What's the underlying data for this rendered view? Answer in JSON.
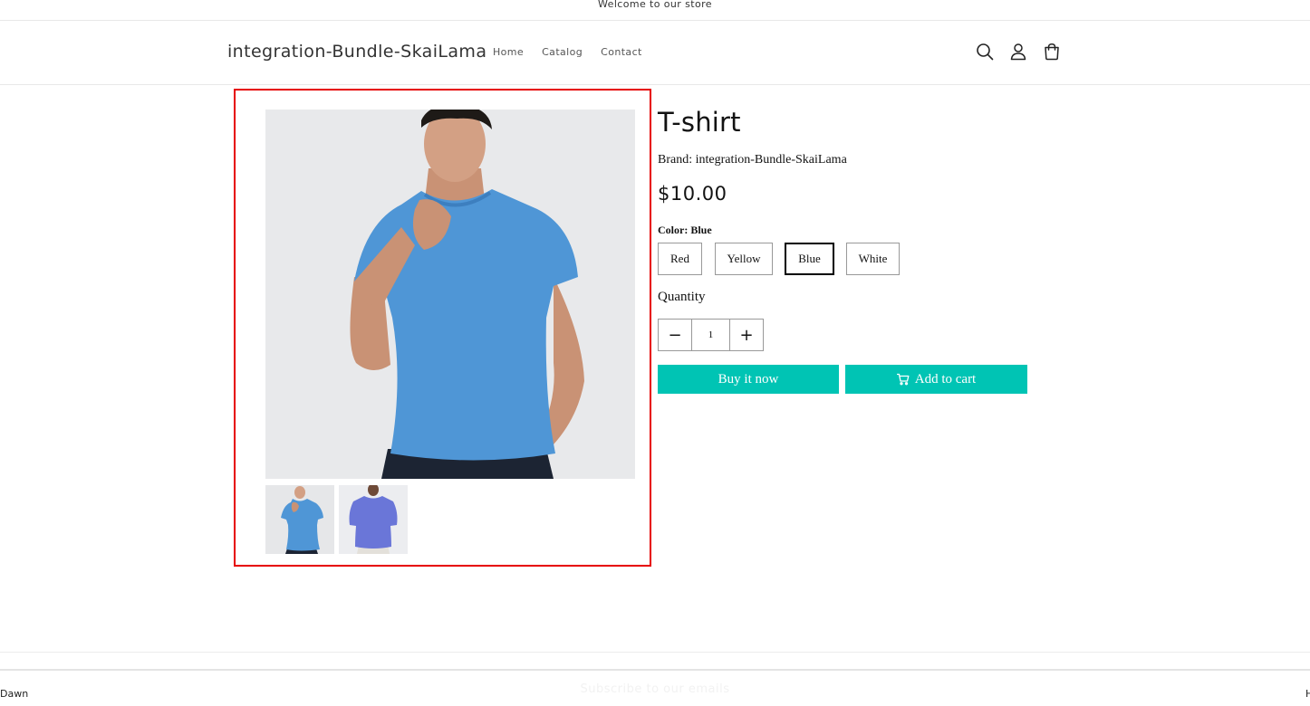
{
  "announcement": {
    "text": "Welcome to our store"
  },
  "header": {
    "logo": "integration-Bundle-SkaiLama",
    "nav": [
      "Home",
      "Catalog",
      "Contact"
    ],
    "icons": [
      "search-icon",
      "account-icon",
      "cart-icon"
    ]
  },
  "product": {
    "title": "T-shirt",
    "brand": "Brand: integration-Bundle-SkaiLama",
    "price": "$10.00",
    "color_label": "Color: Blue",
    "colors": [
      "Red",
      "Yellow",
      "Blue",
      "White"
    ],
    "selected_color": "Blue",
    "quantity_label": "Quantity",
    "quantity_value": "1",
    "minus_symbol": "−",
    "plus_symbol": "+",
    "buy_now_label": "Buy it now",
    "add_to_cart_label": "Add to cart"
  },
  "media": {
    "thumbnail_count": 2
  },
  "footer": {
    "left_text": "Dawn",
    "subscribe_text": "Subscribe to our emails",
    "right_text": "H"
  },
  "colors": {
    "accent": "#00c4b4",
    "highlight_border": "#e60000",
    "shirt_blue": "#4f96d6",
    "shirt_purple": "#6a76d8"
  }
}
